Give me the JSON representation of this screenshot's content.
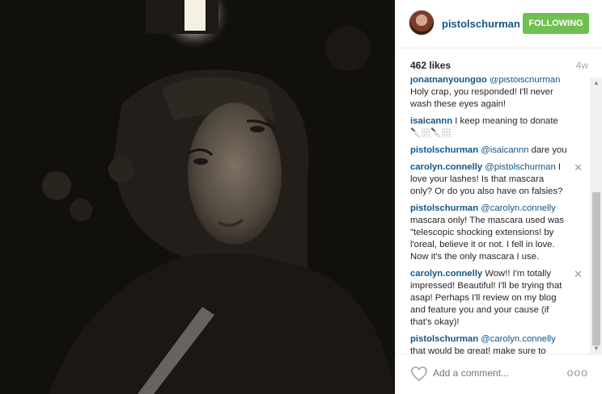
{
  "post": {
    "username": "pistolschurman",
    "follow_label": "FOLLOWING",
    "likes": "462 likes",
    "age": "4w"
  },
  "comments": [
    {
      "user": "jonathanyoungdo",
      "mention": "@pistolschurman",
      "text": "Holy crap, you responded! I'll never wash these eyes again!",
      "deletable": false
    },
    {
      "user": "isaicannn",
      "mention": "",
      "text": "I keep meaning to donate 🔪🏼🔪🏼",
      "deletable": false
    },
    {
      "user": "pistolschurman",
      "mention": "@isaicannn",
      "text": "dare you",
      "deletable": false
    },
    {
      "user": "carolyn.connelly",
      "mention": "@pistolschurman",
      "text": "I love your lashes! Is that mascara only? Or do you also have on falsies?",
      "deletable": true
    },
    {
      "user": "pistolschurman",
      "mention": "@carolyn.connelly",
      "text": "mascara only! The mascara used was \"telescopic shocking extensions! by l'oreal, believe it or not. I fell in love. Now it's the only mascara I use.",
      "deletable": false
    },
    {
      "user": "carolyn.connelly",
      "mention": "",
      "text": "Wow!! I'm totally impressed! Beautiful! I'll be trying that asap! Perhaps I'll review on my blog and feature you and your cause (if that's okay)!",
      "deletable": true
    },
    {
      "user": "pistolschurman",
      "mention": "@carolyn.connelly",
      "text": "that would be great! make sure to send me the link if you do, love ❤",
      "deletable": false
    }
  ],
  "footer": {
    "placeholder": "Add a comment...",
    "more_label": "ooo"
  },
  "icons": {
    "like": "heart-outline-icon",
    "delete": "close-icon",
    "more": "more-options-icon"
  },
  "colors": {
    "username": "#125688",
    "follow_bg": "#70c050",
    "muted": "#a5a7aa",
    "photo_bg": "#0e0d0c"
  }
}
